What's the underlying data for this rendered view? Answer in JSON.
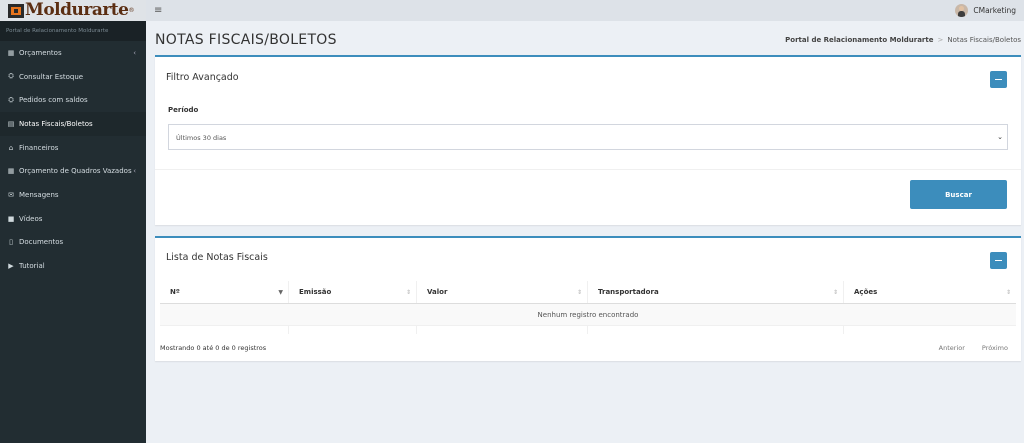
{
  "brand": {
    "name": "Moldurarte",
    "reg": "®"
  },
  "topbar": {
    "menu_icon": "bars-icon",
    "user_name": "CMarketing"
  },
  "sidebar": {
    "header": "Portal de Relacionamento Moldurarte",
    "items": [
      {
        "label": "Orçamentos",
        "icon": "th-icon",
        "glyph": "▦",
        "arrow": "‹"
      },
      {
        "label": "Consultar Estoque",
        "icon": "cubes-icon",
        "glyph": "⛭",
        "arrow": ""
      },
      {
        "label": "Pedidos com saldos",
        "icon": "cubes-icon",
        "glyph": "⛭",
        "arrow": ""
      },
      {
        "label": "Notas Fiscais/Boletos",
        "icon": "file-text-icon",
        "glyph": "▤",
        "arrow": "",
        "active": true
      },
      {
        "label": "Financeiros",
        "icon": "bank-icon",
        "glyph": "⌂",
        "arrow": ""
      },
      {
        "label": "Orçamento de Quadros Vazados",
        "icon": "th-icon",
        "glyph": "▦",
        "arrow": "‹"
      },
      {
        "label": "Mensagens",
        "icon": "envelope-icon",
        "glyph": "✉",
        "arrow": ""
      },
      {
        "label": "Vídeos",
        "icon": "video-camera-icon",
        "glyph": "■",
        "arrow": ""
      },
      {
        "label": "Documentos",
        "icon": "file-icon",
        "glyph": "▯",
        "arrow": ""
      },
      {
        "label": "Tutorial",
        "icon": "play-icon",
        "glyph": "▶",
        "arrow": ""
      }
    ]
  },
  "page": {
    "title": "NOTAS FISCAIS/BOLETOS",
    "breadcrumb": {
      "root": "Portal de Relacionamento Moldurarte",
      "sep": ">",
      "current": "Notas Fiscais/Boletos"
    }
  },
  "filter": {
    "title": "Filtro Avançado",
    "periodo_label": "Período",
    "periodo_value": "Últimos 30 dias",
    "search_button": "Buscar"
  },
  "list": {
    "title": "Lista de Notas Fiscais",
    "columns": [
      "Nº",
      "Emissão",
      "Valor",
      "Transportadora",
      "Ações"
    ],
    "empty_message": "Nenhum registro encontrado",
    "info": "Mostrando 0 até 0 de 0 registros",
    "prev": "Anterior",
    "next": "Próximo"
  },
  "colors": {
    "accent": "#3c8dbc",
    "sidebar_bg": "#222d32",
    "content_bg": "#ecf0f5"
  }
}
